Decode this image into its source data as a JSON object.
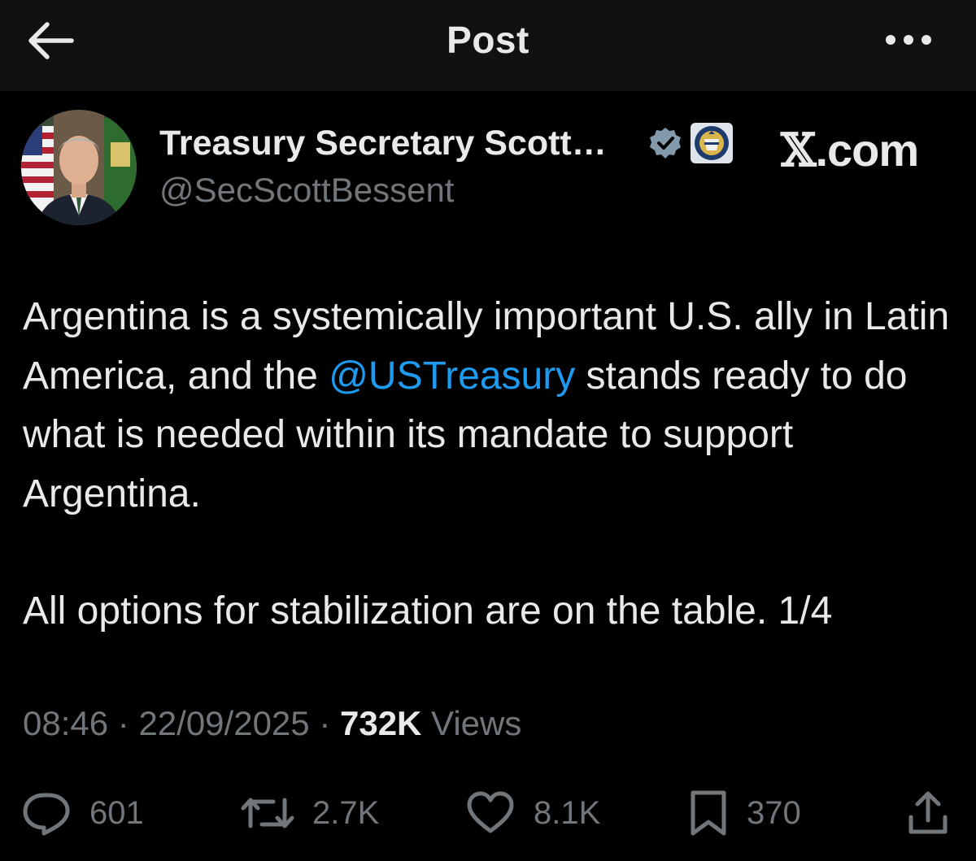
{
  "header": {
    "title": "Post",
    "back_icon": "arrow-left-icon",
    "more_icon": "ellipsis-icon"
  },
  "author": {
    "name": "Treasury Secretary Scott…",
    "handle": "@SecScottBessent",
    "verified_icon": "verified-badge-icon",
    "affiliate_icon": "treasury-seal-icon"
  },
  "watermark": {
    "x": "𝕏",
    "domain": ".com"
  },
  "post": {
    "para1_before": "Argentina is a systemically important U.S. ally in Latin America, and the ",
    "mention": "@USTreasury",
    "para1_after": " stands ready to do what is needed within its mandate to support Argentina.",
    "para2": "All options for stabilization are on the table. 1/4"
  },
  "meta": {
    "time": "08:46",
    "separator": " · ",
    "date": "22/09/2025",
    "views_count": "732K",
    "views_label": " Views"
  },
  "actions": {
    "replies": "601",
    "reposts": "2.7K",
    "likes": "8.1K",
    "bookmarks": "370"
  },
  "colors": {
    "background": "#000000",
    "header_background": "#111111",
    "text": "#e7e9ea",
    "secondary_text": "#71767b",
    "link": "#1d9bf0"
  }
}
